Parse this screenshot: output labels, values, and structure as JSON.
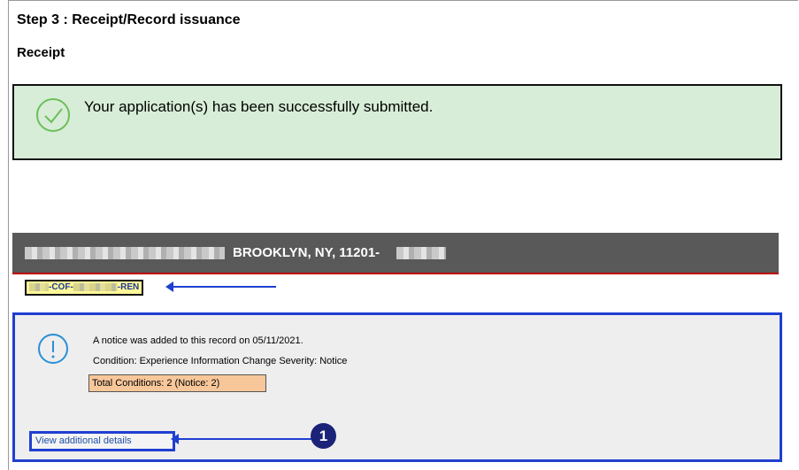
{
  "header": {
    "step_title": "Step 3 : Receipt/Record issuance",
    "section_title": "Receipt"
  },
  "success": {
    "message": "Your application(s) has been successfully submitted.",
    "icon": "check-circle-icon",
    "color": "#d7edd7"
  },
  "record": {
    "address_text": "BROOKLYN, NY, 11201-",
    "id_part1": "-COF-",
    "id_part2": "-REN"
  },
  "notice": {
    "icon": "info-circle-icon",
    "line1": "A notice was added to this record on 05/11/2021.",
    "line2": "Condition: Experience Information Change   Severity: Notice",
    "total_conditions": "Total Conditions: 2  (Notice: 2)",
    "link_label": "View additional details"
  },
  "annotation": {
    "callout_number": "1",
    "highlight_color": "#1f3fd1"
  }
}
